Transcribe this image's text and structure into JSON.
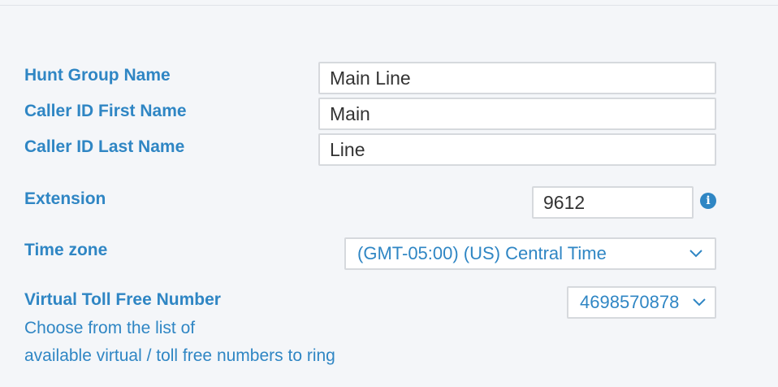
{
  "form": {
    "hunt_group_name": {
      "label": "Hunt Group Name",
      "value": "Main Line"
    },
    "caller_id_first_name": {
      "label": "Caller ID First Name",
      "value": "Main"
    },
    "caller_id_last_name": {
      "label": "Caller ID Last Name",
      "value": "Line"
    },
    "extension": {
      "label": "Extension",
      "value": "9612",
      "info_icon": "i"
    },
    "time_zone": {
      "label": "Time zone",
      "selected": "(GMT-05:00) (US) Central Time"
    },
    "virtual_toll_free": {
      "label": "Virtual Toll Free Number",
      "help_line1": "Choose from the list of",
      "help_line2": "available virtual / toll free numbers to ring",
      "selected": "4698570878"
    }
  },
  "colors": {
    "label": "#2f86c4",
    "input_border": "#d6d9dd",
    "background": "#f4f6f9"
  },
  "icons": {
    "info": "info-circle-icon",
    "dropdown": "chevron-down-icon"
  }
}
